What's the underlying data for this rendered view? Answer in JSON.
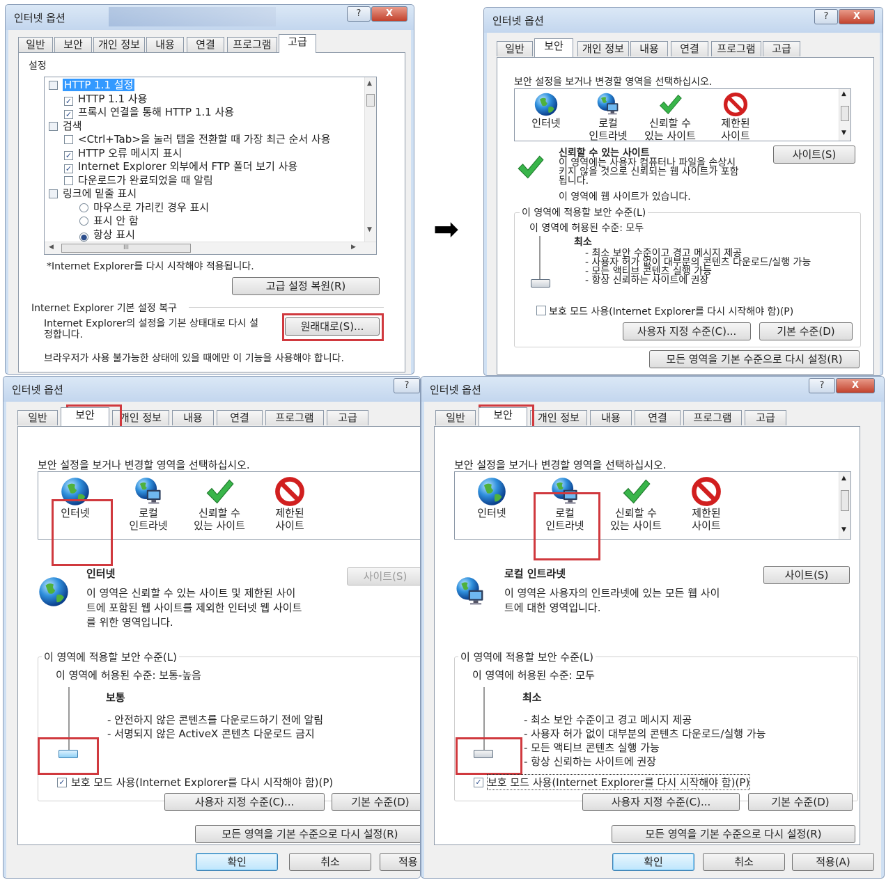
{
  "arrow": "➡",
  "common": {
    "dialog_title": "인터넷 옵션",
    "help_btn": "?",
    "close_btn": "X",
    "tabs": [
      "일반",
      "보안",
      "개인 정보",
      "내용",
      "연결",
      "프로그램",
      "고급"
    ],
    "ok": "확인",
    "cancel": "취소",
    "apply": "적용(A)",
    "apply_cut": "적용"
  },
  "adv": {
    "settings_label": "설정",
    "tree": [
      {
        "kind": "folder",
        "label": "HTTP 1.1 설정",
        "selected": true
      },
      {
        "kind": "check",
        "checked": true,
        "label": "HTTP 1.1 사용"
      },
      {
        "kind": "check",
        "checked": true,
        "label": "프록시 연결을 통해 HTTP 1.1 사용"
      },
      {
        "kind": "folder",
        "label": "검색"
      },
      {
        "kind": "check",
        "checked": false,
        "label": "<Ctrl+Tab>을 눌러 탭을 전환할 때 가장 최근 순서 사용"
      },
      {
        "kind": "check",
        "checked": true,
        "label": "HTTP 오류 메시지 표시"
      },
      {
        "kind": "check",
        "checked": true,
        "label": "Internet Explorer 외부에서 FTP 폴더 보기 사용"
      },
      {
        "kind": "check",
        "checked": false,
        "label": "다운로드가 완료되었을 때 알림"
      },
      {
        "kind": "folder",
        "label": "링크에 밑줄 표시"
      },
      {
        "kind": "radio",
        "checked": false,
        "label": "마우스로 가리킨 경우 표시"
      },
      {
        "kind": "radio",
        "checked": false,
        "label": "표시 안 함"
      },
      {
        "kind": "radio",
        "checked": true,
        "label": "항상 표시"
      }
    ],
    "hscroll_mark": "III",
    "restart_note": "*Internet Explorer를 다시 시작해야 적용됩니다.",
    "restore_adv_btn": "고급 설정 복원(R)",
    "reset_group": "Internet Explorer 기본 설정 복구",
    "reset_desc_1": "Internet Explorer의 설정을 기본 상태대로 다시 설",
    "reset_desc_2": "정합니다.",
    "reset_btn": "원래대로(S)...",
    "reset_note": "브라우저가 사용 불가능한 상태에 있을 때에만 이 기능을 사용해야 합니다."
  },
  "sec": {
    "prompt": "보안 설정을 보거나 변경할 영역을 선택하십시오.",
    "zones": [
      {
        "icon": "globe-icon",
        "line1": "인터넷",
        "line2": ""
      },
      {
        "icon": "intranet-icon",
        "line1": "로컬",
        "line2": "인트라넷"
      },
      {
        "icon": "check-icon",
        "line1": "신뢰할 수",
        "line2": "있는 사이트"
      },
      {
        "icon": "restricted-icon",
        "line1": "제한된",
        "line2": "사이트"
      }
    ],
    "sites_btn": "사이트(S)",
    "custom_btn": "사용자 지정 수준(C)...",
    "default_btn": "기본 수준(D)",
    "reset_all_btn": "모든 영역을 기본 수준으로 다시 설정(R)",
    "group_label": "이 영역에 적용할 보안 수준(L)",
    "protected_mode": "보호 모드 사용(Internet Explorer를 다시 시작해야 함)(P)"
  },
  "trusted": {
    "title": "신뢰할 수 있는 사이트",
    "desc": [
      "이 영역에는 사용자 컴퓨터나 파일을 손상시",
      "키지 않을 것으로 신뢰되는 웹 사이트가 포함",
      "됩니다."
    ],
    "note": "이 영역에 웹 사이트가 있습니다.",
    "allowed": "이 영역에 허용된 수준: 모두",
    "level": "최소",
    "bullets": [
      "- 최소 보안 수준이고 경고 메시지 제공",
      "- 사용자 허가 없이 대부분의 콘텐츠 다운로드/실행 가능",
      "- 모든 액티브 콘텐츠 실행 가능",
      "- 항상 신뢰하는 사이트에 권장"
    ],
    "protected_checked": false
  },
  "internet": {
    "title": "인터넷",
    "desc": [
      "이 영역은 신뢰할 수 있는 사이트 및 제한된 사이",
      "트에 포함된 웹 사이트를 제외한 인터넷 웹 사이트",
      "를 위한 영역입니다."
    ],
    "allowed": "이 영역에 허용된 수준: 보통-높음",
    "level": "보통",
    "bullets": [
      "- 안전하지 않은 콘텐츠를 다운로드하기 전에 알림",
      "- 서명되지 않은 ActiveX 콘텐츠 다운로드 금지"
    ],
    "protected_checked": true
  },
  "intranet": {
    "title": "로컬 인트라넷",
    "desc": [
      "이 영역은 사용자의 인트라넷에 있는 모든 웹 사이",
      "트에 대한 영역입니다."
    ],
    "allowed": "이 영역에 허용된 수준: 모두",
    "level": "최소",
    "bullets": [
      "- 최소 보안 수준이고 경고 메시지 제공",
      "- 사용자 허가 없이 대부분의 콘텐츠 다운로드/실행 가능",
      "- 모든 액티브 콘텐츠 실행 가능",
      "- 항상 신뢰하는 사이트에 권장"
    ],
    "protected_checked": true
  },
  "colors": {
    "highlight": "#d0393e",
    "accent": "#3399ff",
    "titlebar": "#c3d6ee"
  }
}
